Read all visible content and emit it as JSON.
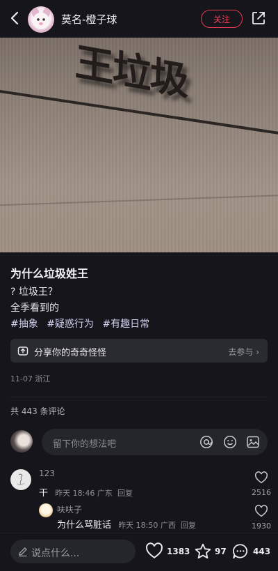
{
  "header": {
    "author": "莫名-橙子球",
    "follow_label": "关注"
  },
  "photo": {
    "sign_text": "王垃圾"
  },
  "post": {
    "title": "为什么垃圾姓王",
    "lines": [
      "? 垃圾王？",
      "全季看到的"
    ],
    "tags": [
      "#抽象",
      "#疑惑行为",
      "#有趣日常"
    ],
    "challenge": {
      "label": "分享你的奇奇怪怪",
      "join_label": "去参与 ›"
    },
    "meta": "11-07 浙江"
  },
  "comments": {
    "count_label": "共 443 条评论",
    "input_placeholder": "留下你的想法吧",
    "items": [
      {
        "user": "123",
        "text": "干",
        "time_location": "昨天 18:46 广东",
        "reply_label": "回复",
        "likes": "2516"
      }
    ],
    "replies": [
      {
        "user": "呋呋子",
        "text": "为什么骂脏话",
        "time_location": "昨天 18:50 广西",
        "reply_label": "回复",
        "likes": "1930"
      }
    ]
  },
  "bottom": {
    "say_placeholder": "说点什么...",
    "likes": "1383",
    "stars": "97",
    "comments": "443"
  },
  "colors": {
    "accent": "#f04359",
    "background": "#16151b",
    "tag": "#cfd2f0"
  },
  "icons": [
    "back-arrow-icon",
    "share-icon",
    "at-icon",
    "emoji-icon",
    "image-icon",
    "heart-icon",
    "star-icon",
    "comment-icon",
    "pen-icon",
    "challenge-icon"
  ]
}
